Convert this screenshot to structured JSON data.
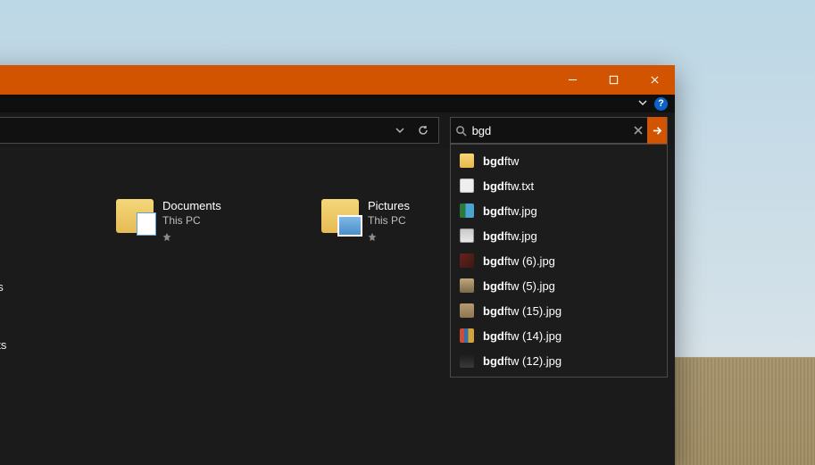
{
  "titlebar": {
    "minimize": "Minimize",
    "maximize": "Maximize",
    "close": "Close"
  },
  "ribbon": {
    "help": "?"
  },
  "search": {
    "query": "bgd",
    "match_prefix": "bgd"
  },
  "suggestions": [
    {
      "icon": "ic-folder",
      "rest": "ftw"
    },
    {
      "icon": "ic-txt",
      "rest": "ftw.txt"
    },
    {
      "icon": "ic-img1",
      "rest": "ftw.jpg"
    },
    {
      "icon": "ic-img2",
      "rest": "ftw.jpg"
    },
    {
      "icon": "ic-img3",
      "rest": "ftw (6).jpg"
    },
    {
      "icon": "ic-img4",
      "rest": "ftw (5).jpg"
    },
    {
      "icon": "ic-img5",
      "rest": "ftw (15).jpg"
    },
    {
      "icon": "ic-img6",
      "rest": "ftw (14).jpg"
    },
    {
      "icon": "ic-img7",
      "rest": "ftw (12).jpg"
    }
  ],
  "quick_access": {
    "documents": {
      "name": "Documents",
      "location": "This PC"
    },
    "pictures": {
      "name": "Pictures",
      "location": "This PC"
    }
  },
  "left_fragments": {
    "a": "ds",
    "b": "ots"
  }
}
